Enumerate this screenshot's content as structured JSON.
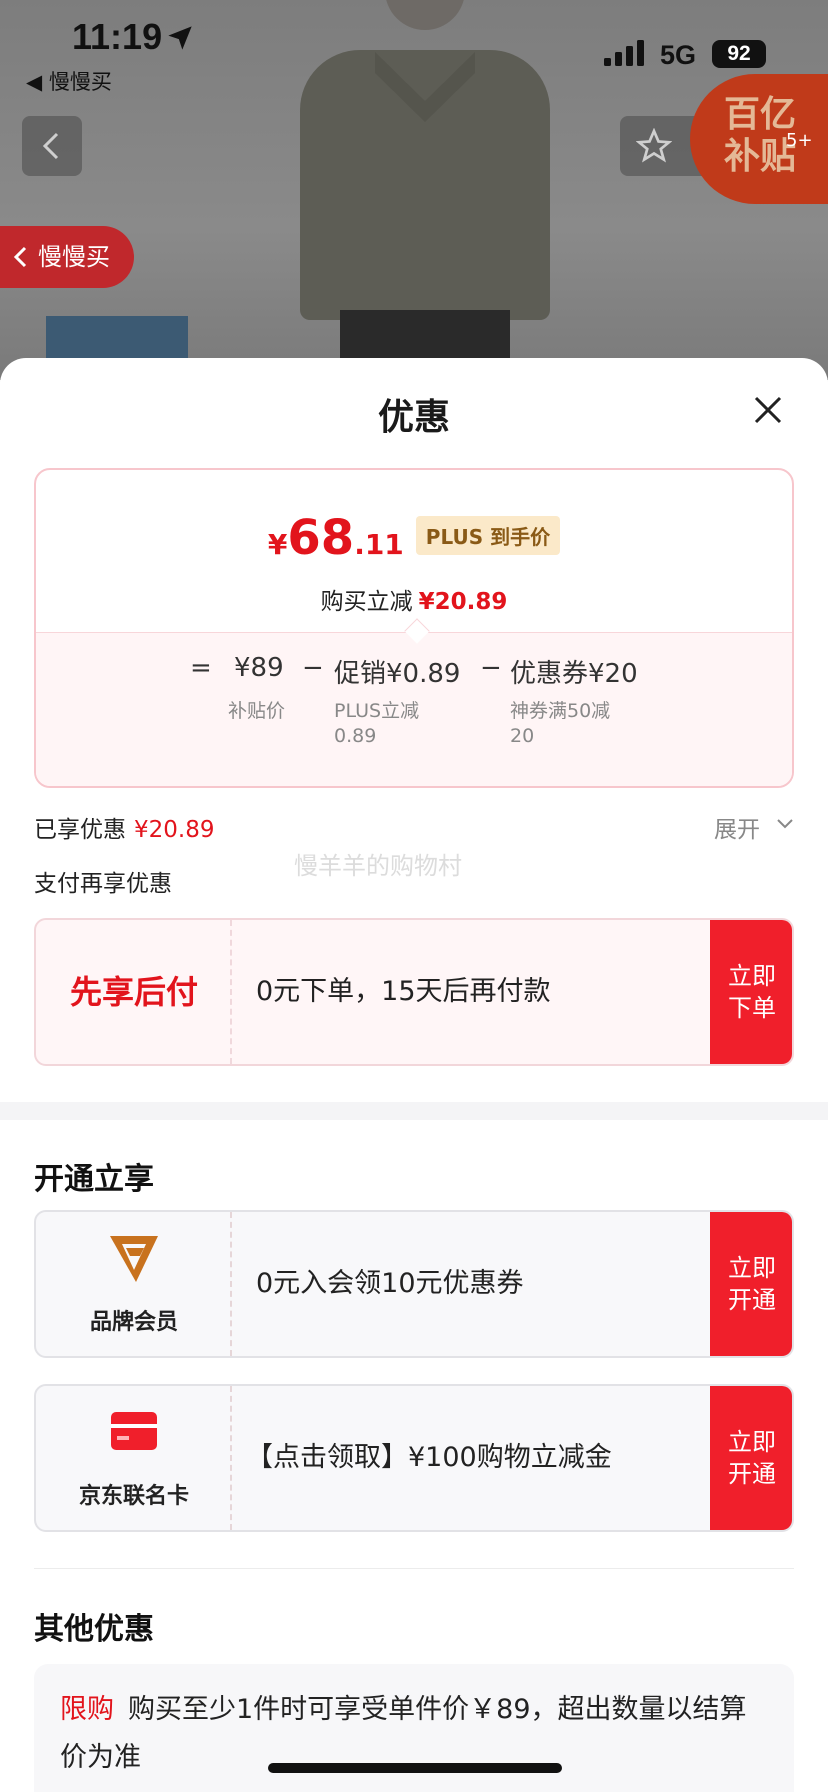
{
  "status_bar": {
    "time": "11:19",
    "back_app": "◀ 慢慢买",
    "network": "5G",
    "battery": "92"
  },
  "product_page": {
    "subsidy_badge": "百亿\n补贴",
    "subsidy_count": "5+",
    "back_pill": "慢慢买"
  },
  "sheet": {
    "title": "优惠",
    "price": {
      "currency": "¥",
      "integer": "68",
      "decimal": ".11",
      "plus_tag": "PLUS 到手价",
      "reduce_label": "购买立减",
      "reduce_value": "¥20.89"
    },
    "formula": {
      "eq": "=",
      "base_value": "¥89",
      "base_label": "补贴价",
      "minus1": "−",
      "promo_value": "促销¥0.89",
      "promo_label": "PLUS立减\n0.89",
      "minus2": "−",
      "coupon_value": "优惠券¥20",
      "coupon_label": "神券满50减\n20"
    },
    "enjoyed_label": "已享优惠",
    "enjoyed_value": "¥20.89",
    "expand_label": "展开",
    "watermark": "慢羊羊的购物村",
    "pay_more_label": "支付再享优惠",
    "pay_later": {
      "label": "先享后付",
      "desc": "0元下单，15天后再付款",
      "cta": "立即\n下单"
    },
    "open_section_title": "开通立享",
    "brand_member": {
      "label": "品牌会员",
      "desc": "0元入会领10元优惠券",
      "cta": "立即\n开通"
    },
    "co_card": {
      "label": "京东联名卡",
      "desc": "【点击领取】¥100购物立减金",
      "cta": "立即\n开通"
    },
    "other_section_title": "其他优惠",
    "limit": {
      "tag": "限购",
      "text": "购买至少1件时可享受单件价￥89，超出数量以结算价为准"
    }
  },
  "colors": {
    "accent_red": "#e2141c",
    "cta_red": "#f01f2b",
    "brand_orange": "#c8721e"
  }
}
